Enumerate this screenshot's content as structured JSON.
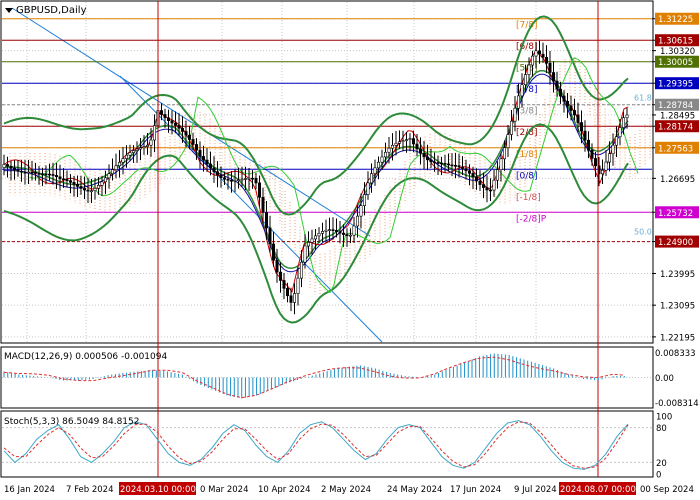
{
  "window": {
    "symbol_title": "GBPUSD,Daily"
  },
  "colors": {
    "grid": "#c8c8c8",
    "price_line": "#000000",
    "candle": "#000000",
    "bb": "#2e8b3a",
    "lime": "#32cd32",
    "tenkan": "#cc0000",
    "kijun": "#1010a0",
    "cloud": "#f0a070",
    "trend": "#1e7fd8",
    "vline": "#c00000",
    "macd_hist": "#1e90c8",
    "macd_signal": "#e03030",
    "stoch_main": "#3da8c8",
    "stoch_signal": "#e03030",
    "tag_blue": "#0000c0",
    "tag_red": "#c00000",
    "tag_green": "#507000",
    "tag_orange": "#e08000",
    "tag_magenta": "#d000d0",
    "tag_maroon": "#a00000",
    "tag_gray_text": "#000000"
  },
  "chart_data": [
    {
      "type": "candlestick",
      "title": "GBPUSD,Daily",
      "ylim": [
        1.2205,
        1.317
      ],
      "x_ticks": [
        "16 Jan 2024",
        "7 Feb 2024",
        "2024.03.10 00:00",
        "0 Mar 2024",
        "10 Apr 2024",
        "2 May 2024",
        "24 May 2024",
        "17 Jun 2024",
        "9 Jul 2024",
        "2024.08.07 00:00",
        "00 Sep 2024"
      ],
      "highlighted_x_ticks": [
        "2024.03.10 00:00",
        "2024.08.07 00:00"
      ],
      "y_ticks": [
        "1.22195",
        "1.23095",
        "1.23995",
        "1.24900",
        "1.25732",
        "1.26695",
        "1.27563",
        "1.28174",
        "1.28495",
        "1.28784",
        "1.29395",
        "1.30005",
        "1.30320",
        "1.30615",
        "1.31225"
      ],
      "price_tags": [
        {
          "value": 1.31225,
          "label": "1.31225",
          "color": "orange"
        },
        {
          "value": 1.30615,
          "label": "1.30615",
          "color": "maroon"
        },
        {
          "value": 1.30005,
          "label": "1.30005",
          "color": "green"
        },
        {
          "value": 1.29395,
          "label": "1.29395",
          "color": "blue"
        },
        {
          "value": 1.28784,
          "label": "1.28784",
          "color": "gray"
        },
        {
          "value": 1.28174,
          "label": "1.28174",
          "color": "maroon"
        },
        {
          "value": 1.27563,
          "label": "1.27563",
          "color": "orange"
        },
        {
          "value": 1.26953,
          "label": "1.26953",
          "color": "blue"
        },
        {
          "value": 1.25732,
          "label": "1.25732",
          "color": "magenta"
        },
        {
          "value": 1.249,
          "label": "1.24900",
          "color": "maroon"
        }
      ],
      "murrey_labels": [
        "[7/8]",
        "[6/8]",
        "[5/8]",
        "[4/8]",
        "[3/8]",
        "[2/8]",
        "[1/8]",
        "[0/8]",
        "[-1/8]",
        "[-2/8]P"
      ],
      "fib_labels": [
        "61.8",
        "50.0"
      ],
      "indicators": [
        "Bollinger Bands",
        "Ichimoku",
        "Moving Average"
      ]
    },
    {
      "type": "bar",
      "title": "MACD(12,26,9) 0.000506 -0.001094",
      "y_ticks": [
        "0.008333",
        "0.00",
        "-0.008314"
      ],
      "ylim": [
        -0.0095,
        0.0095
      ],
      "series": [
        {
          "name": "histogram",
          "values": [
            0.002,
            0.001,
            0.0005,
            0.0,
            -0.001,
            -0.001,
            -0.0005,
            0.0008,
            0.0015,
            0.002,
            0.0025,
            0.002,
            0.001,
            -0.002,
            -0.004,
            -0.006,
            -0.007,
            -0.006,
            -0.004,
            -0.002,
            -0.0005,
            0.001,
            0.0025,
            0.0035,
            0.004,
            0.003,
            0.0015,
            0.0005,
            0.0,
            0.001,
            0.003,
            0.005,
            0.007,
            0.008,
            0.0075,
            0.006,
            0.0045,
            0.003,
            0.001,
            -0.0005,
            -0.001,
            0.0005
          ]
        }
      ]
    },
    {
      "type": "line",
      "title": "Stoch(5,3,3) 86.5049 84.8152",
      "y_ticks": [
        "100",
        "80",
        "20",
        "0"
      ],
      "ylim": [
        0,
        100
      ],
      "series": [
        {
          "name": "main",
          "values": [
            40,
            20,
            35,
            60,
            75,
            85,
            60,
            30,
            20,
            35,
            55,
            80,
            90,
            85,
            60,
            35,
            20,
            15,
            25,
            45,
            70,
            85,
            75,
            50,
            30,
            20,
            40,
            70,
            85,
            90,
            80,
            60,
            40,
            25,
            35,
            60,
            80,
            85,
            80,
            55,
            30,
            15,
            10,
            20,
            45,
            70,
            88,
            92,
            85,
            65,
            40,
            20,
            10,
            8,
            15,
            35,
            65,
            86
          ]
        },
        {
          "name": "signal",
          "values": [
            45,
            30,
            30,
            50,
            68,
            80,
            68,
            45,
            28,
            30,
            48,
            70,
            85,
            86,
            72,
            48,
            28,
            18,
            22,
            38,
            60,
            78,
            78,
            60,
            40,
            25,
            35,
            60,
            78,
            86,
            84,
            68,
            48,
            30,
            32,
            52,
            72,
            82,
            82,
            62,
            40,
            22,
            12,
            16,
            36,
            60,
            80,
            90,
            88,
            72,
            50,
            28,
            14,
            10,
            12,
            28,
            55,
            84.8
          ]
        }
      ]
    }
  ]
}
